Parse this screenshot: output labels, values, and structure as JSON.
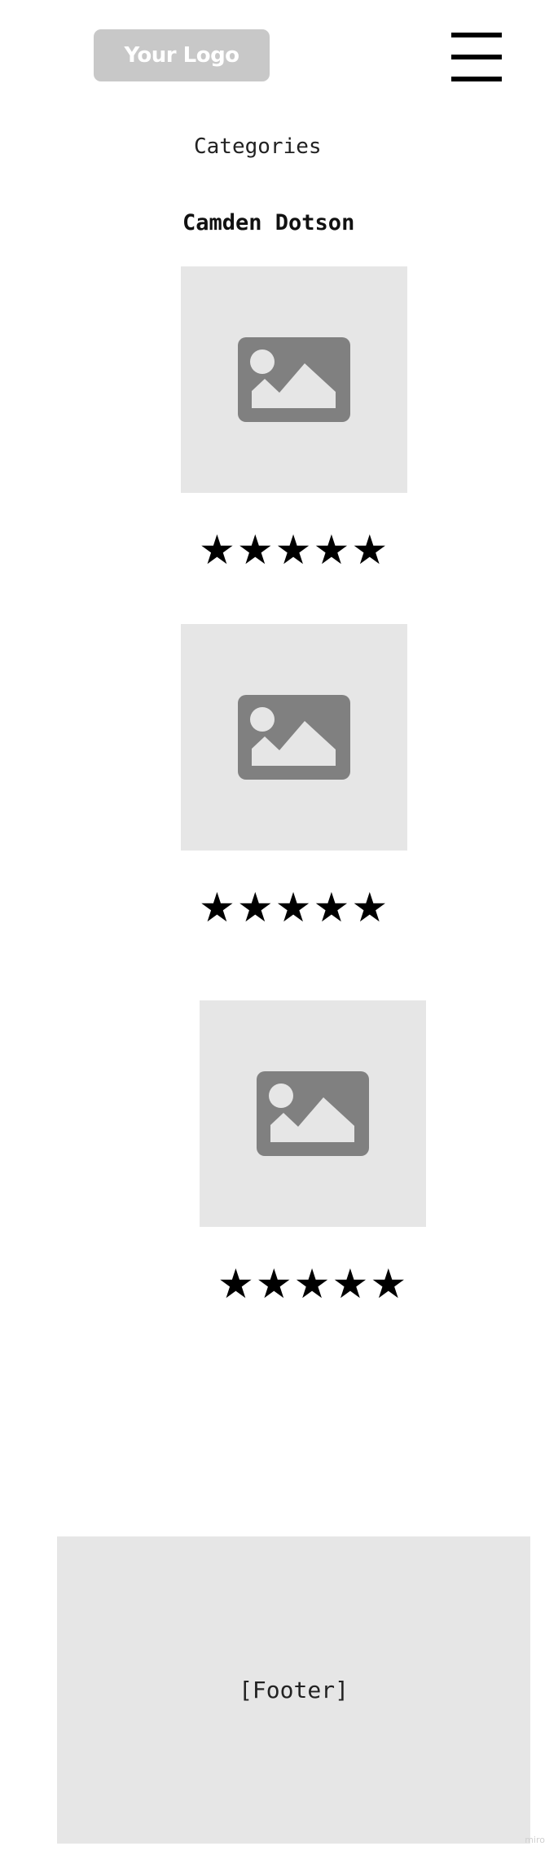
{
  "header": {
    "logo_text": "Your Logo",
    "menu_icon": "hamburger-menu-icon"
  },
  "nav": {
    "categories_label": "Categories"
  },
  "author": {
    "name": "Camden Dotson"
  },
  "products": [
    {
      "image_icon": "image-placeholder-icon",
      "rating": 5,
      "max_rating": 5,
      "star_glyph": "★"
    },
    {
      "image_icon": "image-placeholder-icon",
      "rating": 5,
      "max_rating": 5,
      "star_glyph": "★"
    },
    {
      "image_icon": "image-placeholder-icon",
      "rating": 5,
      "max_rating": 5,
      "star_glyph": "★"
    }
  ],
  "footer": {
    "label": "[Footer]"
  },
  "watermark": {
    "text": "miro"
  },
  "colors": {
    "placeholder_bg": "#e6e6e6",
    "logo_bg": "#c8c8c8",
    "icon_gray": "#808080"
  }
}
